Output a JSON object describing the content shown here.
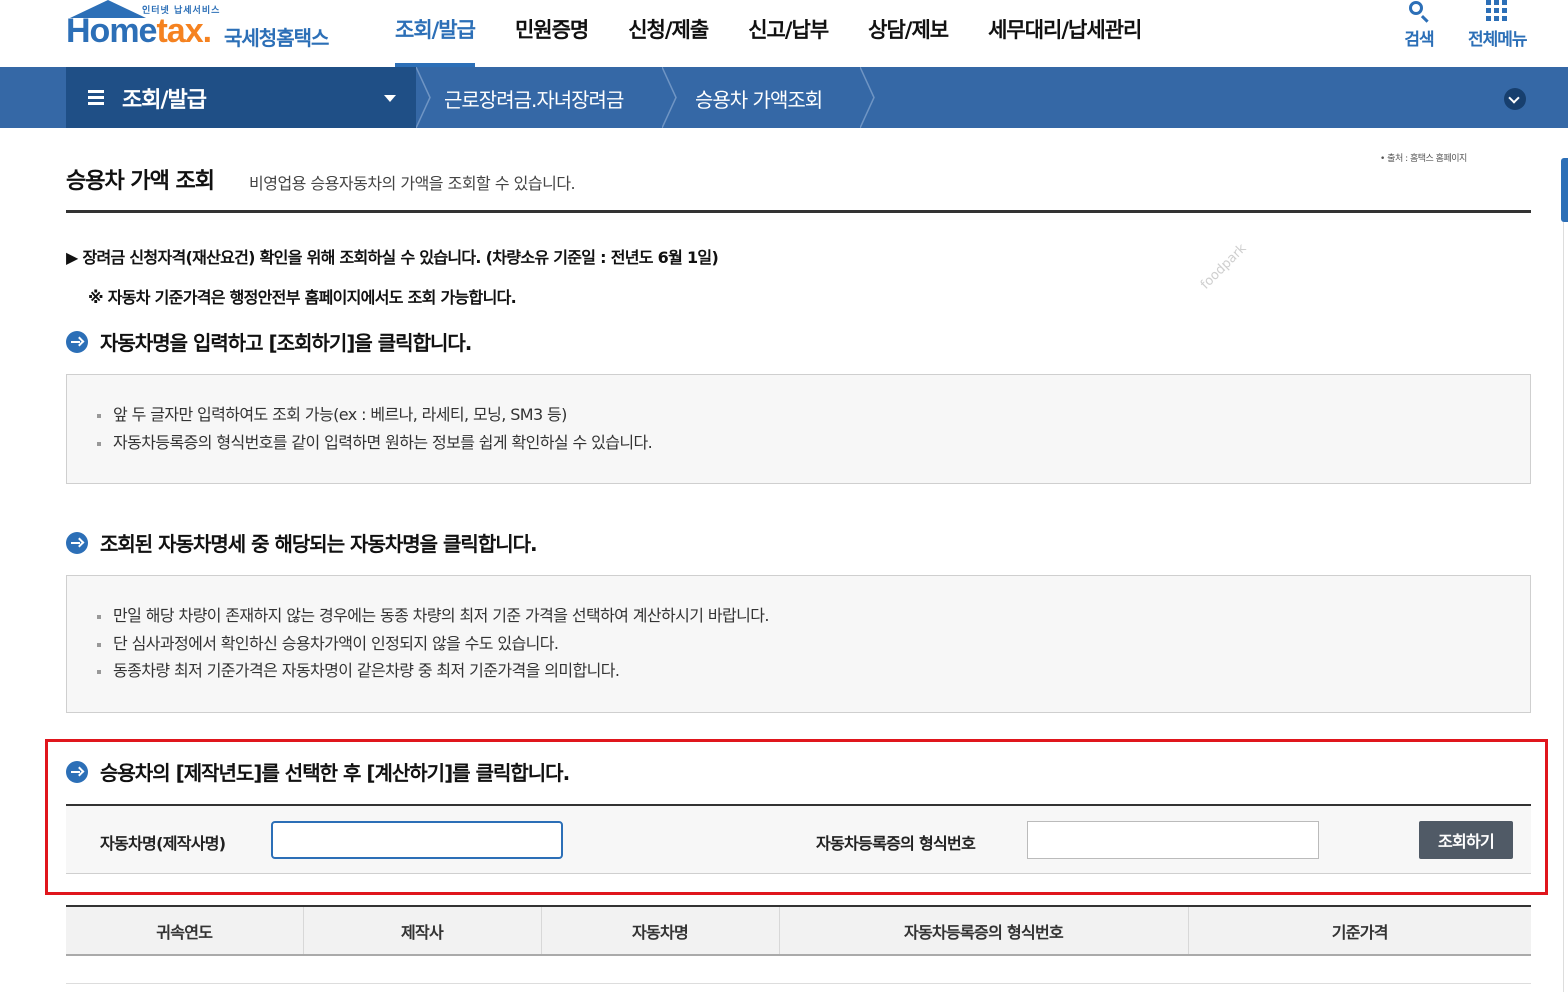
{
  "header": {
    "logo_tagline": "인터넷 납세서비스",
    "logo_brand_home": "Home",
    "logo_brand_tax": "tax.",
    "logo_brand_korean": "국세청홈택스",
    "nav": [
      {
        "label": "조회/발급",
        "active": true
      },
      {
        "label": "민원증명",
        "active": false
      },
      {
        "label": "신청/제출",
        "active": false
      },
      {
        "label": "신고/납부",
        "active": false
      },
      {
        "label": "상담/제보",
        "active": false
      },
      {
        "label": "세무대리/납세관리",
        "active": false
      }
    ],
    "search_label": "검색",
    "all_menu_label": "전체메뉴"
  },
  "location_bar": {
    "home_label": "조회/발급",
    "breadcrumbs": [
      "근로장려금.자녀장려금",
      "승용차 가액조회"
    ]
  },
  "page": {
    "source_note": "• 출처 : 홈택스 홈페이지",
    "watermark": "foodpark",
    "title": "승용차 가액 조회",
    "description": "비영업용 승용자동차의 가액을 조회할 수 있습니다.",
    "notice_1": "▶ 장려금 신청자격(재산요건) 확인을 위해 조회하실 수 있습니다. (차량소유 기준일 : 전년도 6월 1일)",
    "notice_2": "※ 자동차 기준가격은 행정안전부 홈페이지에서도 조회 가능합니다."
  },
  "steps": [
    {
      "title": "자동차명을 입력하고 [조회하기]을 클릭합니다.",
      "bullets": [
        "앞 두 글자만 입력하여도 조회 가능(ex : 베르나, 라세티, 모닝, SM3 등)",
        "자동차등록증의 형식번호를 같이 입력하면 원하는 정보를 쉽게 확인하실 수 있습니다."
      ]
    },
    {
      "title": "조회된 자동차명세 중 해당되는 자동차명을 클릭합니다.",
      "bullets": [
        "만일 해당 차량이 존재하지 않는 경우에는 동종 차량의 최저 기준 가격을 선택하여 계산하시기 바랍니다.",
        "단 심사과정에서 확인하신 승용차가액이 인정되지 않을 수도 있습니다.",
        "동종차량 최저 기준가격은 자동차명이 같은차량 중  최저 기준가격을 의미합니다."
      ]
    },
    {
      "title": "승용차의 [제작년도]를 선택한 후 [계산하기]를 클릭합니다."
    }
  ],
  "search_form": {
    "car_name_label": "자동차명(제작사명)",
    "car_name_value": "",
    "type_number_label": "자동차등록증의 형식번호",
    "type_number_value": "",
    "submit_label": "조회하기"
  },
  "result_table": {
    "columns": [
      "귀속연도",
      "제작사",
      "자동차명",
      "자동차등록증의 형식번호",
      "기준가격"
    ]
  },
  "colors": {
    "brand_blue": "#2c6fb7",
    "location_bar": "#3568a6",
    "location_bar_dark": "#1f4f86",
    "brand_orange": "#f58220",
    "highlight_red": "#e0161d",
    "button_gray": "#505a66"
  }
}
